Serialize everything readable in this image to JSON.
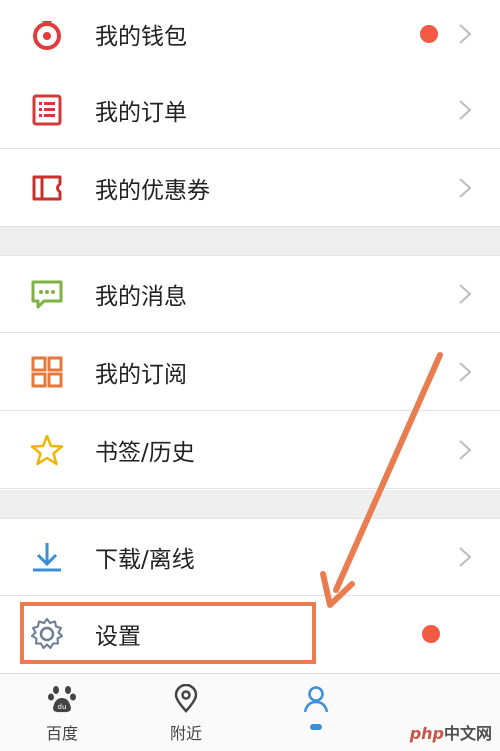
{
  "menu": {
    "wallet": "我的钱包",
    "orders": "我的订单",
    "coupons": "我的优惠券",
    "messages": "我的消息",
    "subscriptions": "我的订阅",
    "bookmarks": "书签/历史",
    "downloads": "下载/离线",
    "settings": "设置"
  },
  "tabs": {
    "home": "百度",
    "nearby": "附近"
  },
  "watermark": {
    "php": "php",
    "cn": "中文网"
  },
  "colors": {
    "red_dot": "#f25a43",
    "highlight": "#ea7d4f",
    "wallet_icon": "#e23b3b",
    "orders_icon": "#d23a3a",
    "coupons_icon": "#c9302c",
    "messages_icon": "#7cb342",
    "subscriptions_icon": "#e8773a",
    "bookmarks_icon": "#f2b600",
    "downloads_icon": "#3a8fd6",
    "settings_icon": "#6b7c93",
    "active_tab": "#3a8fd6"
  },
  "icons": {
    "wallet": "wallet-icon",
    "orders": "order-list-icon",
    "coupons": "coupon-icon",
    "messages": "message-bubble-icon",
    "subscriptions": "grid-icon",
    "bookmarks": "star-icon",
    "downloads": "download-icon",
    "settings": "gear-icon",
    "home_tab": "baidu-paw-icon",
    "nearby_tab": "location-pin-icon",
    "me_tab": "person-icon"
  }
}
